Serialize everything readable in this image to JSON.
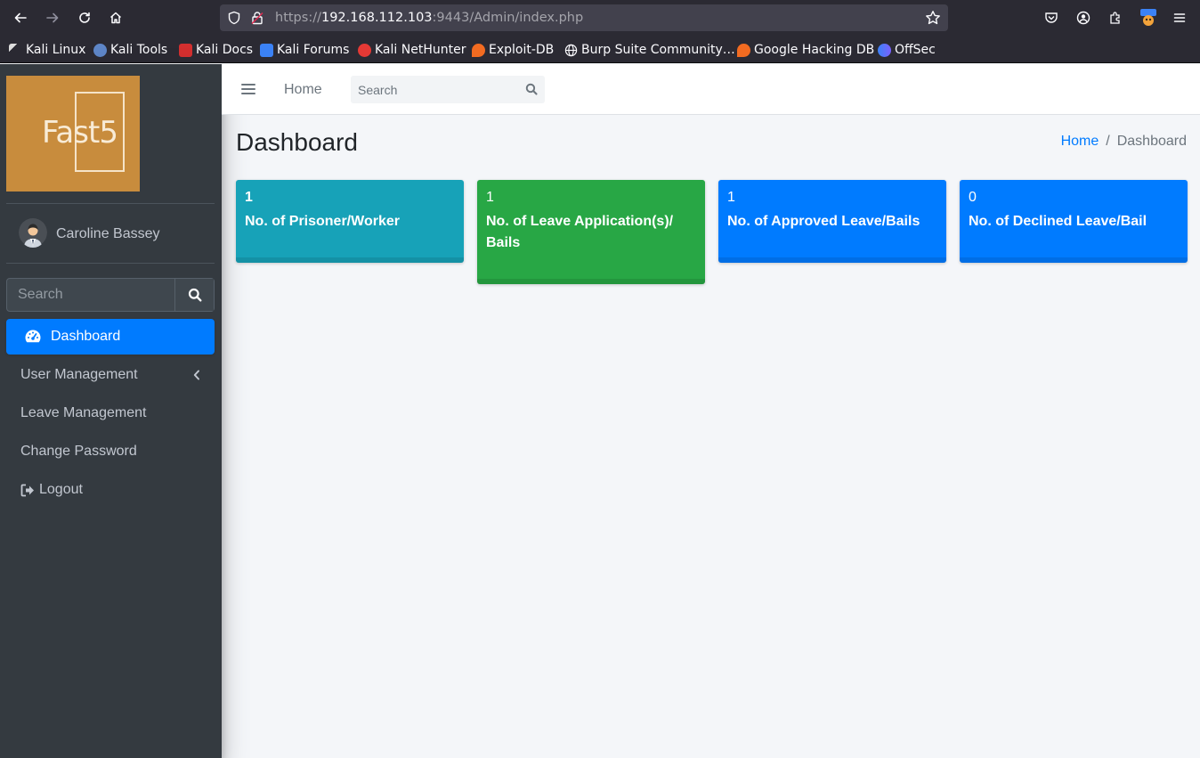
{
  "browser": {
    "url_prefix": "https://",
    "url_host": "192.168.112.103",
    "url_rest": ":9443/Admin/index.php",
    "bookmarks": [
      {
        "label": "Kali Linux",
        "icon": "kali-dragon-icon",
        "color": "#dddddd"
      },
      {
        "label": "Kali Tools",
        "icon": "kali-tools-icon",
        "color": "#5e86c8"
      },
      {
        "label": "Kali Docs",
        "icon": "kali-docs-icon",
        "color": "#d32f2f"
      },
      {
        "label": "Kali Forums",
        "icon": "kali-forums-icon",
        "color": "#3b82f6"
      },
      {
        "label": "Kali NetHunter",
        "icon": "nethunter-icon",
        "color": "#e53935"
      },
      {
        "label": "Exploit-DB",
        "icon": "exploit-db-icon",
        "color": "#f26b21"
      },
      {
        "label": "Burp Suite Community…",
        "icon": "globe-icon",
        "color": "#dddddd"
      },
      {
        "label": "Google Hacking DB",
        "icon": "ghdb-icon",
        "color": "#f26b21"
      },
      {
        "label": "OffSec",
        "icon": "offsec-icon",
        "color": "#7b61ff"
      }
    ]
  },
  "sidebar": {
    "logo_text": "Fast5",
    "user_name": "Caroline Bassey",
    "search_placeholder": "Search",
    "items": [
      {
        "label": "Dashboard",
        "active": true
      },
      {
        "label": "User Management"
      },
      {
        "label": "Leave Management"
      },
      {
        "label": "Change Password"
      },
      {
        "label": "Logout"
      }
    ]
  },
  "header": {
    "home_link": "Home",
    "search_placeholder": "Search"
  },
  "page": {
    "title": "Dashboard",
    "breadcrumb": {
      "home": "Home",
      "separator": "/",
      "current": "Dashboard"
    }
  },
  "stats": [
    {
      "value": "1",
      "label": "No. of Prisoner/Worker",
      "color": "#17a2b8"
    },
    {
      "value": "1",
      "label": "No. of Leave Application(s)/ Bails",
      "color": "#28a745"
    },
    {
      "value": "1",
      "label": "No. of Approved Leave/Bails",
      "color": "#007bff"
    },
    {
      "value": "0",
      "label": "No. of Declined Leave/Bail",
      "color": "#007bff"
    }
  ]
}
